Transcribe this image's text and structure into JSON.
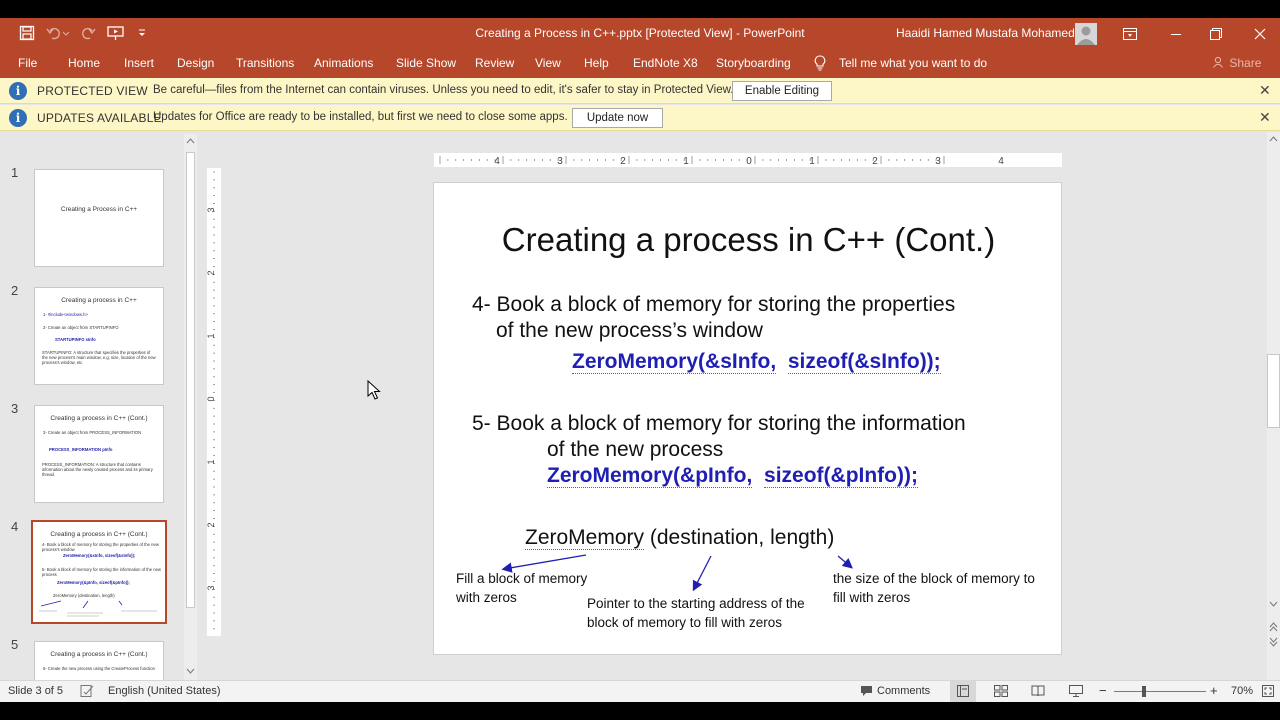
{
  "window": {
    "title": "Creating a Process in C++.pptx [Protected View]  -  PowerPoint",
    "user": "Haaidi Hamed Mustafa Mohamed"
  },
  "ribbon": {
    "tabs": [
      "File",
      "Home",
      "Insert",
      "Design",
      "Transitions",
      "Animations",
      "Slide Show",
      "Review",
      "View",
      "Help",
      "EndNote X8",
      "Storyboarding"
    ],
    "tell_me": "Tell me what you want to do",
    "share": "Share"
  },
  "protected_bar": {
    "title": "PROTECTED VIEW",
    "message": "Be careful—files from the Internet can contain viruses. Unless you need to edit, it's safer to stay in Protected View.",
    "button": "Enable Editing"
  },
  "updates_bar": {
    "title": "UPDATES AVAILABLE",
    "message": "Updates for Office are ready to be installed, but first we need to close some apps.",
    "button": "Update now"
  },
  "thumbnails": {
    "numbers": [
      "1",
      "2",
      "3",
      "4",
      "5"
    ],
    "t1_title": "Creating a Process in C++",
    "t2_title": "Creating a process in C++",
    "t2_l1": "1- #include<windows.h>",
    "t2_l2": "2- Create an object from STARTUPINFO",
    "t2_code": "STARTUPINFO sInfo",
    "t2_l3": "STARTUPINFO: A structure that specifies the properties of the new process's main window, e.g. size, location of the new process's window, etc",
    "t3_title": "Creating a process in C++ (Cont.)",
    "t3_l1": "3- Create an object from PROCESS_INFORMATION",
    "t3_code": "PROCESS_INFORMATION pInfo",
    "t3_l2": "PROCESS_INFORMATION: A structure that contains information about the newly created process and its primary thread.",
    "t4_title": "Creating a process in C++ (Cont.)",
    "t4_l1": "4- Book a block of memory for storing the properties of the new process's window",
    "t4_code1": "ZeroMemory(&sInfo, sizeof(&sInfo));",
    "t4_l2": "5- Book a block of memory for storing the information of the new process",
    "t4_code2": "ZeroMemory(&pInfo, sizeof(&pInfo));",
    "t4_l3": "ZeroMemory (destination, length)",
    "t5_title": "Creating a process in C++ (Cont.)",
    "t5_l1": "6- Create the new process using the CreateProcess function"
  },
  "slide": {
    "title": "Creating a process in C++ (Cont.)",
    "item4_line1": "4- Book a block of memory for storing the properties",
    "item4_line2": "of the new process’s window",
    "code1_a": "ZeroMemory(&sInfo,",
    "code1_b": "sizeof(&sInfo));",
    "item5_line1": "5- Book a block of memory for storing the information",
    "item5_line2": "of the new process",
    "code2_a": "ZeroMemory(&pInfo,",
    "code2_b": "sizeof(&pInfo));",
    "signature_name": "ZeroMemory",
    "signature_args": " (destination, length)",
    "note_left": "Fill a block of memory with zeros",
    "note_middle": "Pointer to the starting address of the block of memory to fill with zeros",
    "note_right": "the size of the block of memory to fill with zeros"
  },
  "ruler": {
    "h_labels": [
      "4",
      "3",
      "2",
      "1",
      "0",
      "1",
      "2",
      "3",
      "4"
    ],
    "v_labels": [
      "3",
      "2",
      "1",
      "0",
      "1",
      "2",
      "3"
    ]
  },
  "status": {
    "slide_info": "Slide 3 of 5",
    "language": "English (United States)",
    "comments": "Comments",
    "zoom": "70%"
  },
  "colors": {
    "accent": "#b7472a",
    "code_blue": "#1f1fb4",
    "message_bar": "#fdf6c7"
  }
}
